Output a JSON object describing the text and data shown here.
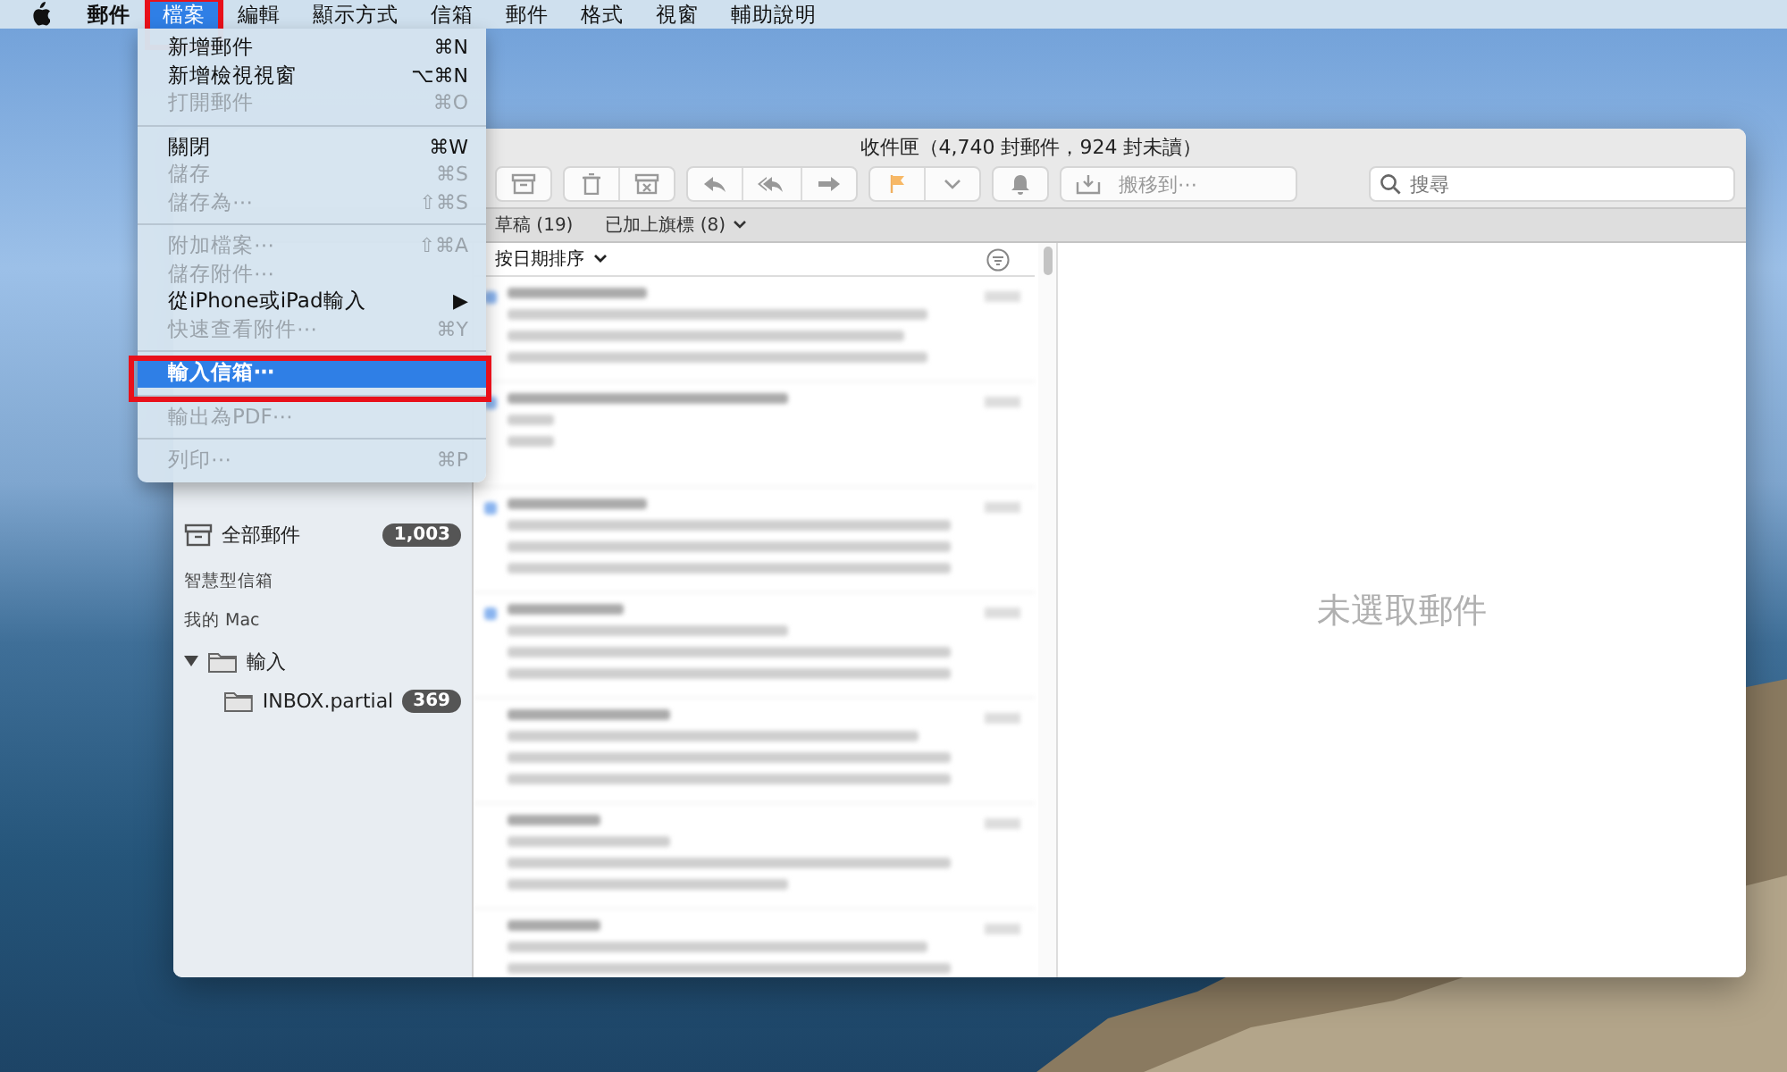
{
  "menu_bar": {
    "items": [
      {
        "label": "郵件",
        "kind": "app",
        "selected": false,
        "annotated": false
      },
      {
        "label": "檔案",
        "kind": "menu",
        "selected": true,
        "annotated": true
      },
      {
        "label": "編輯",
        "kind": "menu",
        "selected": false,
        "annotated": false
      },
      {
        "label": "顯示方式",
        "kind": "menu",
        "selected": false,
        "annotated": false
      },
      {
        "label": "信箱",
        "kind": "menu",
        "selected": false,
        "annotated": false
      },
      {
        "label": "郵件",
        "kind": "menu",
        "selected": false,
        "annotated": false
      },
      {
        "label": "格式",
        "kind": "menu",
        "selected": false,
        "annotated": false
      },
      {
        "label": "視窗",
        "kind": "menu",
        "selected": false,
        "annotated": false
      },
      {
        "label": "輔助說明",
        "kind": "menu",
        "selected": false,
        "annotated": false
      }
    ]
  },
  "file_menu": {
    "items": [
      {
        "kind": "item",
        "label": "新增郵件",
        "shortcut": "⌘N",
        "disabled": false,
        "selected": false,
        "annotated": false
      },
      {
        "kind": "item",
        "label": "新增檢視視窗",
        "shortcut": "⌥⌘N",
        "disabled": false,
        "selected": false,
        "annotated": false
      },
      {
        "kind": "item",
        "label": "打開郵件",
        "shortcut": "⌘O",
        "disabled": true,
        "selected": false,
        "annotated": false
      },
      {
        "kind": "separator"
      },
      {
        "kind": "item",
        "label": "關閉",
        "shortcut": "⌘W",
        "disabled": false,
        "selected": false,
        "annotated": false
      },
      {
        "kind": "item",
        "label": "儲存",
        "shortcut": "⌘S",
        "disabled": true,
        "selected": false,
        "annotated": false
      },
      {
        "kind": "item",
        "label": "儲存為⋯",
        "shortcut": "⇧⌘S",
        "disabled": true,
        "selected": false,
        "annotated": false
      },
      {
        "kind": "separator"
      },
      {
        "kind": "item",
        "label": "附加檔案⋯",
        "shortcut": "⇧⌘A",
        "disabled": true,
        "selected": false,
        "annotated": false
      },
      {
        "kind": "item",
        "label": "儲存附件⋯",
        "disabled": true,
        "selected": false,
        "annotated": false
      },
      {
        "kind": "submenu",
        "label": "從iPhone或iPad輸入",
        "shortcut": "▶",
        "disabled": false,
        "selected": false,
        "annotated": false
      },
      {
        "kind": "item",
        "label": "快速查看附件⋯",
        "shortcut": "⌘Y",
        "disabled": true,
        "selected": false,
        "annotated": false
      },
      {
        "kind": "separator"
      },
      {
        "kind": "item",
        "label": "輸入信箱⋯",
        "disabled": false,
        "selected": true,
        "annotated": true
      },
      {
        "kind": "separator"
      },
      {
        "kind": "item",
        "label": "輸出為PDF⋯",
        "disabled": true,
        "selected": false,
        "annotated": false
      },
      {
        "kind": "separator"
      },
      {
        "kind": "item",
        "label": "列印⋯",
        "shortcut": "⌘P",
        "disabled": true,
        "selected": false,
        "annotated": false
      }
    ]
  },
  "window": {
    "title": "收件匣（4,740 封郵件，924 封未讀）",
    "toolbar": {
      "move_button": "搬移到⋯",
      "search": {
        "placeholder": "搜尋"
      }
    },
    "favorites_bar": [
      {
        "label": "草稿 (19)",
        "dropdown": false
      },
      {
        "label": "已加上旗標 (8)",
        "dropdown": true
      }
    ],
    "sidebar": {
      "items": [
        {
          "kind": "mailbox",
          "label": "全部郵件",
          "badge": "1,003"
        },
        {
          "kind": "section",
          "label": "智慧型信箱"
        },
        {
          "kind": "section",
          "label": "我的 Mac"
        },
        {
          "kind": "folder",
          "label": "輸入",
          "expanded": true,
          "children": [
            {
              "kind": "folder",
              "label": "INBOX.partial",
              "badge": "369"
            }
          ]
        }
      ]
    },
    "message_list": {
      "sort": "按日期排序",
      "messages": [
        {
          "unread": true
        },
        {
          "unread": true
        },
        {
          "unread": true
        },
        {
          "unread": true
        },
        {
          "unread": false
        },
        {
          "unread": false
        },
        {
          "unread": false
        }
      ]
    },
    "preview": {
      "empty_text": "未選取郵件"
    }
  }
}
